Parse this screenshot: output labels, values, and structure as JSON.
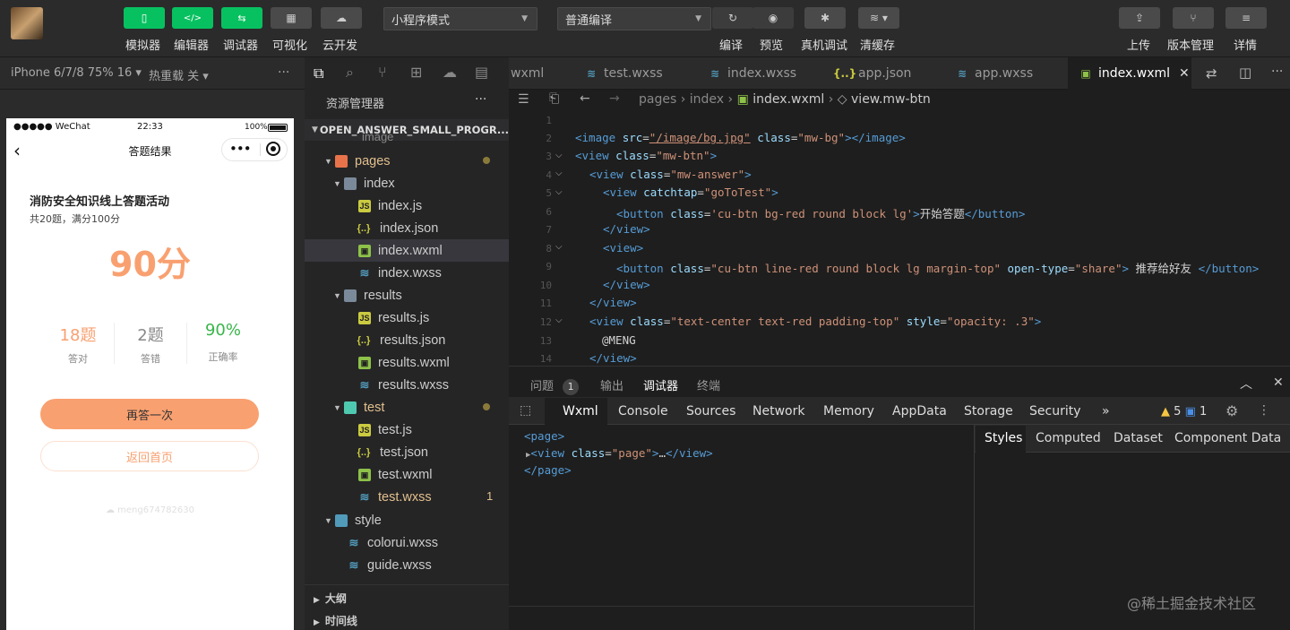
{
  "toolbar": {
    "buttons": [
      {
        "label": "模拟器",
        "icon": "phone-icon"
      },
      {
        "label": "编辑器",
        "icon": "code-icon"
      },
      {
        "label": "调试器",
        "icon": "debug-icon"
      },
      {
        "label": "可视化",
        "icon": "layout-icon"
      },
      {
        "label": "云开发",
        "icon": "cloud-icon"
      }
    ],
    "mode_select": "小程序模式",
    "compile_select": "普通编译",
    "actions": [
      "编译",
      "预览",
      "真机调试",
      "清缓存"
    ],
    "right_actions": [
      "上传",
      "版本管理",
      "详情"
    ]
  },
  "subbar": {
    "device": "iPhone 6/7/8 75% 16 ▾",
    "hotreload": "热重载 关 ▾",
    "more": "···",
    "tabs": [
      {
        "label": "wxml"
      },
      {
        "label": "test.wxss"
      },
      {
        "label": "index.wxss"
      },
      {
        "label": "app.json"
      },
      {
        "label": "app.wxss"
      },
      {
        "label": "index.wxml"
      }
    ]
  },
  "phone": {
    "carrier": "●●●●● WeChat",
    "time": "22:33",
    "battery": "100%",
    "nav_title": "答题结果",
    "quiz_title": "消防安全知识线上答题活动",
    "quiz_sub": "共20题，满分100分",
    "score": "90分",
    "stats": [
      {
        "value": "18题",
        "label": "答对"
      },
      {
        "value": "2题",
        "label": "答错"
      },
      {
        "value": "90%",
        "label": "正确率"
      }
    ],
    "retry": "再答一次",
    "home": "返回首页",
    "footer": "☁ meng674782630",
    "colors": {
      "accent": "#f9a070",
      "green": "#39b54a"
    }
  },
  "explorer": {
    "title": "资源管理器",
    "more": "···",
    "project": "OPEN_ANSWER_SMALL_PROGR...",
    "items": [
      {
        "label": "image"
      },
      {
        "label": "pages"
      },
      {
        "label": "index"
      },
      {
        "label": "index.js"
      },
      {
        "label": "index.json"
      },
      {
        "label": "index.wxml"
      },
      {
        "label": "index.wxss"
      },
      {
        "label": "results"
      },
      {
        "label": "results.js"
      },
      {
        "label": "results.json"
      },
      {
        "label": "results.wxml"
      },
      {
        "label": "results.wxss"
      },
      {
        "label": "test"
      },
      {
        "label": "test.js"
      },
      {
        "label": "test.json"
      },
      {
        "label": "test.wxml"
      },
      {
        "label": "test.wxss"
      },
      {
        "label": "style"
      },
      {
        "label": "colorui.wxss"
      },
      {
        "label": "guide.wxss"
      }
    ],
    "badge": "1",
    "outline": "大纲",
    "timeline": "时间线"
  },
  "editor": {
    "breadcrumb": [
      "pages",
      "index",
      "index.wxml",
      "view.mw-btn"
    ],
    "line_numbers": [
      "1",
      "2",
      "3",
      "4",
      "5",
      "6",
      "7",
      "8",
      "9",
      "10",
      "11",
      "12",
      "13",
      "14"
    ]
  },
  "panel": {
    "tabs": [
      "问题",
      "输出",
      "调试器",
      "终端"
    ],
    "problem_count": "1",
    "devtabs": [
      "Wxml",
      "Console",
      "Sources",
      "Network",
      "Memory",
      "AppData",
      "Storage",
      "Security",
      "»"
    ],
    "warn_count": "5",
    "info_count": "1",
    "styles_tabs": [
      "Styles",
      "Computed",
      "Dataset",
      "Component Data"
    ],
    "watermark": "@稀土掘金技术社区"
  }
}
